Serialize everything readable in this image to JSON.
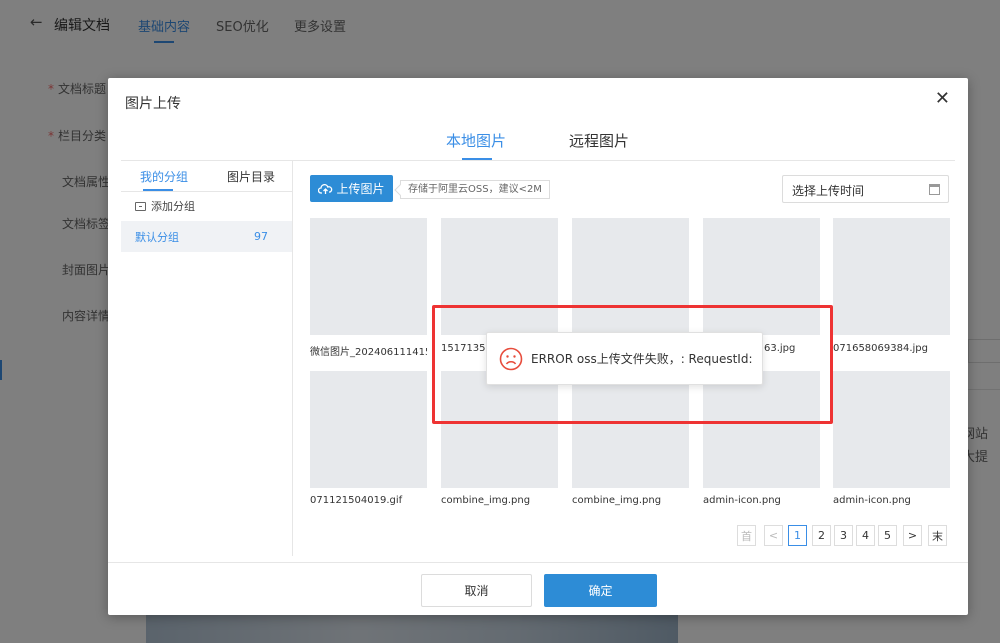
{
  "background": {
    "back_arrow": "←",
    "title": "编辑文档",
    "tabs": [
      "基础内容",
      "SEO优化",
      "更多设置"
    ],
    "labels": [
      "文档标题",
      "栏目分类",
      "文档属性",
      "文档标签",
      "封面图片",
      "内容详情"
    ],
    "right_fragments": [
      "网站",
      "大提"
    ]
  },
  "dialog": {
    "title": "图片上传",
    "close": "✕",
    "tabs": [
      "本地图片",
      "远程图片"
    ],
    "left_tabs": [
      "我的分组",
      "图片目录"
    ],
    "add_group": "添加分组",
    "groups": [
      {
        "name": "默认分组",
        "count": "97"
      }
    ],
    "upload_button": "上传图片",
    "upload_tip": "存储于阿里云OSS，建议<2M",
    "date_placeholder": "选择上传时间",
    "images": [
      {
        "caption": "微信图片_202406111415"
      },
      {
        "caption": "15171352"
      },
      {
        "caption": ""
      },
      {
        "caption": "63.jpg"
      },
      {
        "caption": "071658069384.jpg"
      },
      {
        "caption": "071121504019.gif"
      },
      {
        "caption": "combine_img.png"
      },
      {
        "caption": "combine_img.png"
      },
      {
        "caption": "admin-icon.png"
      },
      {
        "caption": "admin-icon.png"
      }
    ],
    "pagination": [
      "首",
      "<",
      "1",
      "2",
      "3",
      "4",
      "5",
      ">",
      "末"
    ],
    "cancel": "取消",
    "confirm": "确定"
  },
  "error_toast": {
    "message": "ERROR oss上传文件失败，: RequestId:"
  },
  "colors": {
    "accent": "#3a8ee6",
    "primary_button": "#2d8cd6",
    "highlight_box": "#ee3333",
    "error_icon": "#e74c3c"
  }
}
